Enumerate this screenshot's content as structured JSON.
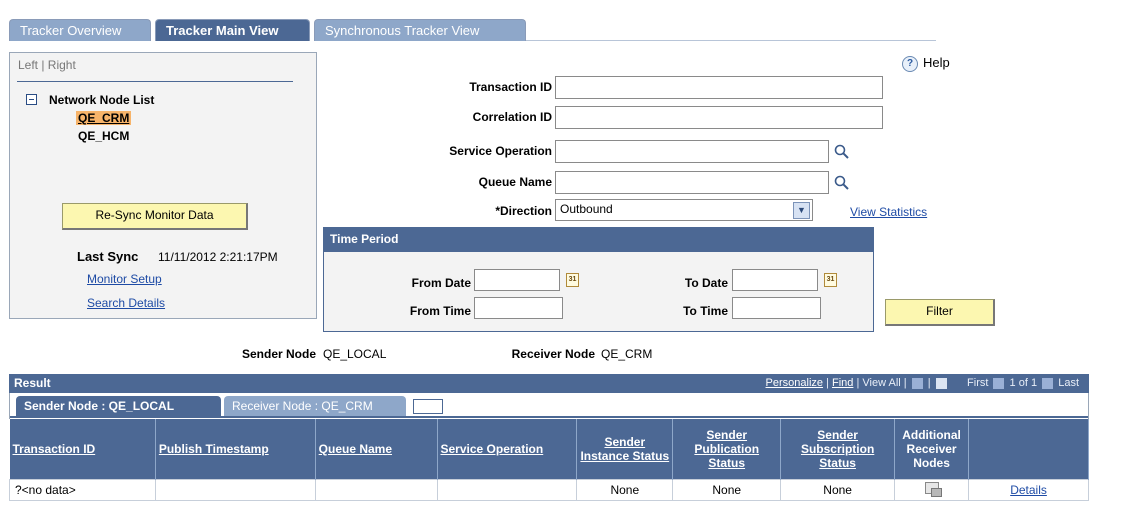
{
  "tabs": [
    "Tracker Overview",
    "Tracker Main View",
    "Synchronous Tracker View"
  ],
  "left_panel": {
    "left_right": "Left | Right",
    "tree_title": "Network Node List",
    "nodes": [
      "QE_CRM",
      "QE_HCM"
    ],
    "resync_label": "Re-Sync Monitor Data",
    "last_sync_label": "Last Sync",
    "last_sync_value": "11/11/2012 2:21:17PM",
    "monitor_setup": "Monitor Setup",
    "search_details": "Search Details"
  },
  "help": "Help",
  "form": {
    "transaction_id_label": "Transaction ID",
    "correlation_id_label": "Correlation ID",
    "service_operation_label": "Service Operation",
    "queue_name_label": "Queue Name",
    "direction_label": "*Direction",
    "direction_value": "Outbound",
    "view_statistics": "View Statistics"
  },
  "time_period": {
    "title": "Time Period",
    "from_date": "From Date",
    "to_date": "To Date",
    "from_time": "From Time",
    "to_time": "To Time",
    "calendar_text": "31"
  },
  "filter_label": "Filter",
  "sender_node_label": "Sender Node",
  "sender_node_value": "QE_LOCAL",
  "receiver_node_label": "Receiver Node",
  "receiver_node_value": "QE_CRM",
  "result": {
    "title": "Result",
    "personalize": "Personalize",
    "find": "Find",
    "view_all": "View All",
    "first": "First",
    "range": "1 of 1",
    "last": "Last",
    "subtabs": [
      "Sender Node : QE_LOCAL",
      "Receiver Node : QE_CRM"
    ],
    "columns": [
      "Transaction ID",
      "Publish Timestamp",
      "Queue Name",
      "Service Operation",
      "Sender Instance Status",
      "Sender Publication Status",
      "Sender Subscription Status",
      "Additional Receiver Nodes",
      ""
    ],
    "row": {
      "transaction_id": "?<no data>",
      "publish_timestamp": "",
      "queue_name": "",
      "service_operation": "",
      "instance_status": "None",
      "publication_status": "None",
      "subscription_status": "None",
      "details": "Details"
    }
  }
}
